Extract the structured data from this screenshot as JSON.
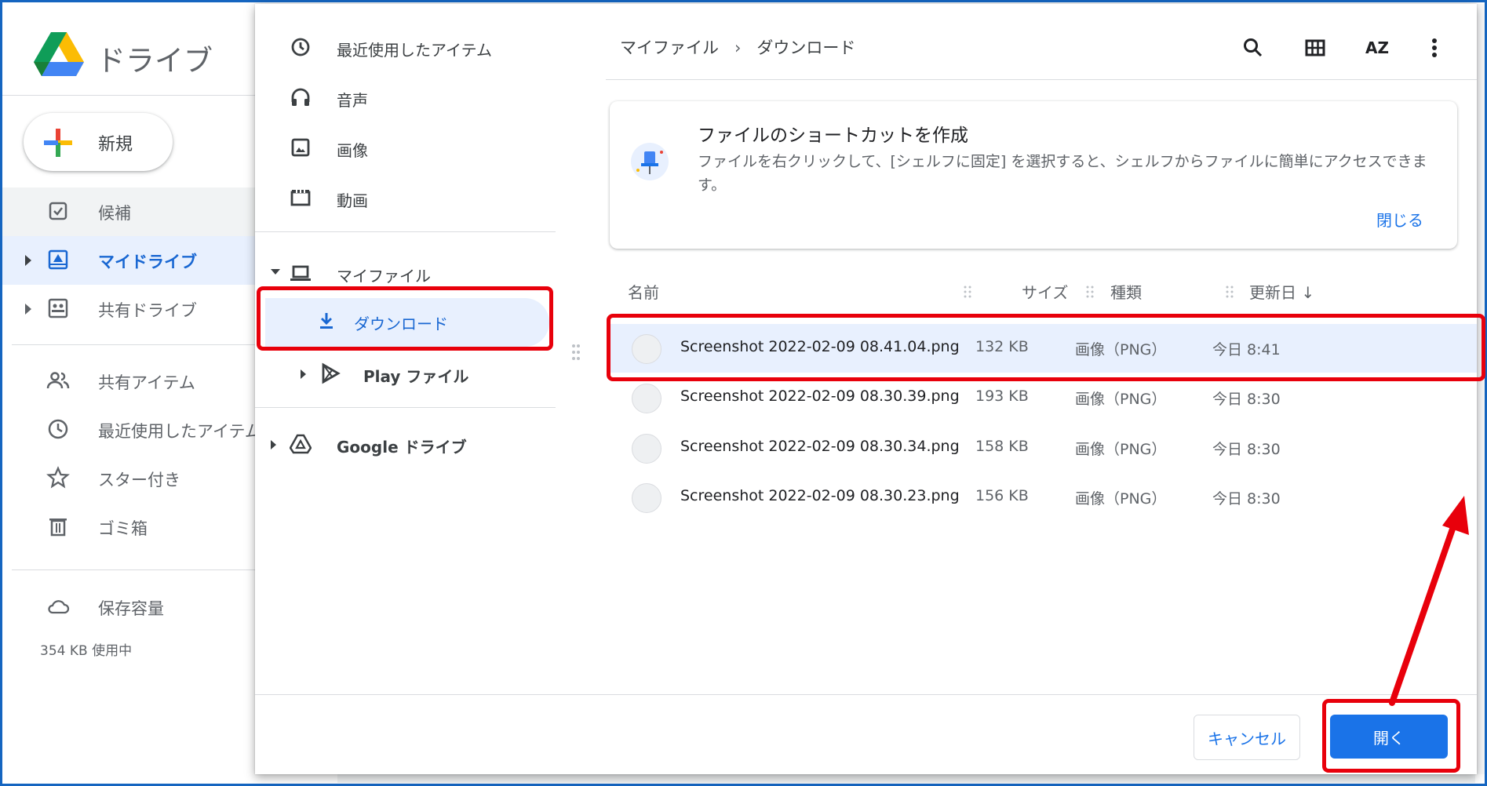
{
  "drive": {
    "title": "ドライブ",
    "new_label": "新規",
    "nav": [
      {
        "label": "候補",
        "icon": "check-box-icon"
      },
      {
        "label": "マイドライブ",
        "icon": "my-drive-icon"
      },
      {
        "label": "共有ドライブ",
        "icon": "shared-drive-icon"
      },
      {
        "label": "共有アイテム",
        "icon": "people-icon"
      },
      {
        "label": "最近使用したアイテム",
        "icon": "clock-icon"
      },
      {
        "label": "スター付き",
        "icon": "star-icon"
      },
      {
        "label": "ゴミ箱",
        "icon": "trash-icon"
      },
      {
        "label": "保存容量",
        "icon": "cloud-icon"
      }
    ],
    "storage_used": "354 KB 使用中"
  },
  "dialog": {
    "nav": {
      "recent": "最近使用したアイテム",
      "audio": "音声",
      "images": "画像",
      "videos": "動画",
      "my_files": "マイファイル",
      "downloads": "ダウンロード",
      "play_files": "Play ファイル",
      "google_drive": "Google ドライブ"
    },
    "breadcrumb": {
      "root": "マイファイル",
      "separator": "›",
      "current": "ダウンロード"
    },
    "toolbar": {
      "search": "search-icon",
      "grid": "grid-view-icon",
      "sort": "AZ",
      "more": "more-vert-icon"
    },
    "banner": {
      "title": "ファイルのショートカットを作成",
      "text": "ファイルを右クリックして、[シェルフに固定] を選択すると、シェルフからファイルに簡単にアクセスできます。",
      "close": "閉じる"
    },
    "columns": {
      "name": "名前",
      "size": "サイズ",
      "type": "種類",
      "date": "更新日",
      "sort_arrow": "↓"
    },
    "files": [
      {
        "name": "Screenshot 2022-02-09 08.41.04.png",
        "size": "132 KB",
        "type": "画像（PNG）",
        "date": "今日 8:41"
      },
      {
        "name": "Screenshot 2022-02-09 08.30.39.png",
        "size": "193 KB",
        "type": "画像（PNG）",
        "date": "今日 8:30"
      },
      {
        "name": "Screenshot 2022-02-09 08.30.34.png",
        "size": "158 KB",
        "type": "画像（PNG）",
        "date": "今日 8:30"
      },
      {
        "name": "Screenshot 2022-02-09 08.30.23.png",
        "size": "156 KB",
        "type": "画像（PNG）",
        "date": "今日 8:30"
      }
    ],
    "buttons": {
      "cancel": "キャンセル",
      "open": "開く"
    }
  },
  "colors": {
    "accent": "#1a73e8",
    "selected_bg": "#e8f0fe",
    "highlight": "#e8000b",
    "frame": "#1565c0"
  }
}
